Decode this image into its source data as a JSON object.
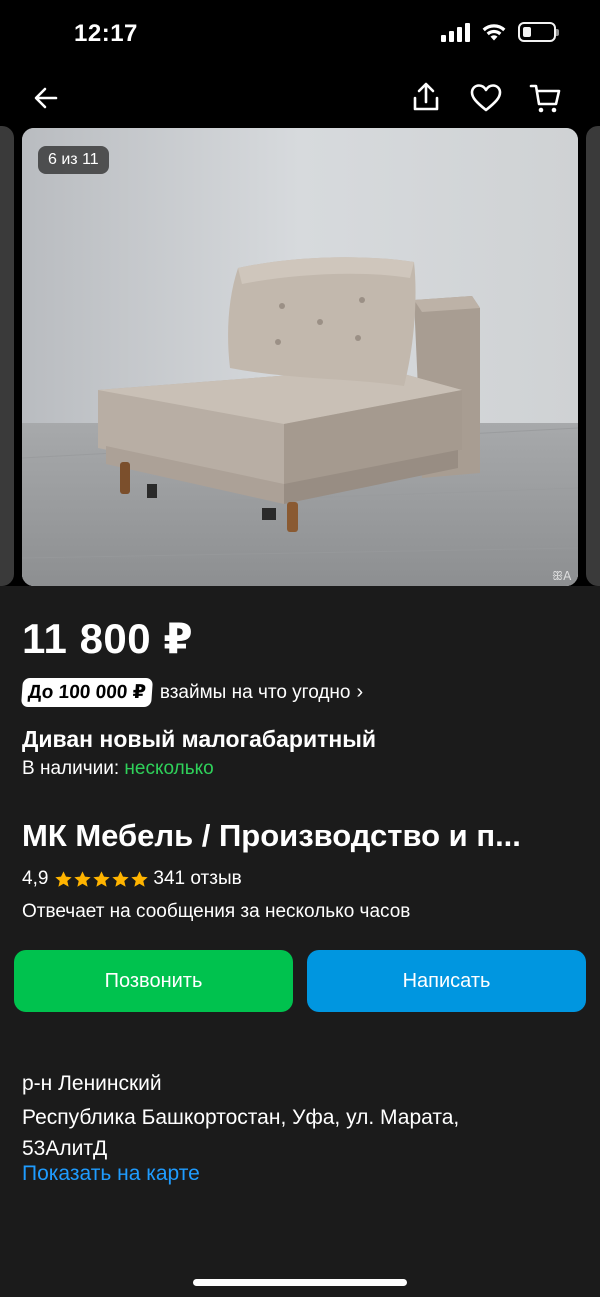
{
  "status_bar": {
    "time": "12:17",
    "battery_level": 0.3
  },
  "nav": {
    "back_icon": "arrow-left-icon",
    "share_icon": "share-icon",
    "favorite_icon": "heart-icon",
    "cart_icon": "cart-icon"
  },
  "gallery": {
    "counter": "6 из 11"
  },
  "listing": {
    "price": "11 800 ₽",
    "loan_badge": "До 100 000 ₽",
    "loan_text": "взаймы на что угодно",
    "title": "Диван новый малогабаритный",
    "stock_label": "В наличии:",
    "stock_value": "несколько"
  },
  "seller": {
    "name": "МК Мебель / Производство и п...",
    "rating": "4,9",
    "stars": 5,
    "reviews": "341 отзыв",
    "response_time": "Отвечает на сообщения за несколько часов"
  },
  "actions": {
    "call_label": "Позвонить",
    "write_label": "Написать"
  },
  "address": {
    "district": "р-н Ленинский",
    "line": "Республика Башкортостан, Уфа, ул. Марата, 53АлитД",
    "map_link": "Показать на карте"
  },
  "colors": {
    "background": "#1b1b1b",
    "green": "#00c24e",
    "blue": "#0096e0",
    "link": "#1f9cff",
    "star": "#ffb400",
    "in_stock": "#2fd15a"
  }
}
